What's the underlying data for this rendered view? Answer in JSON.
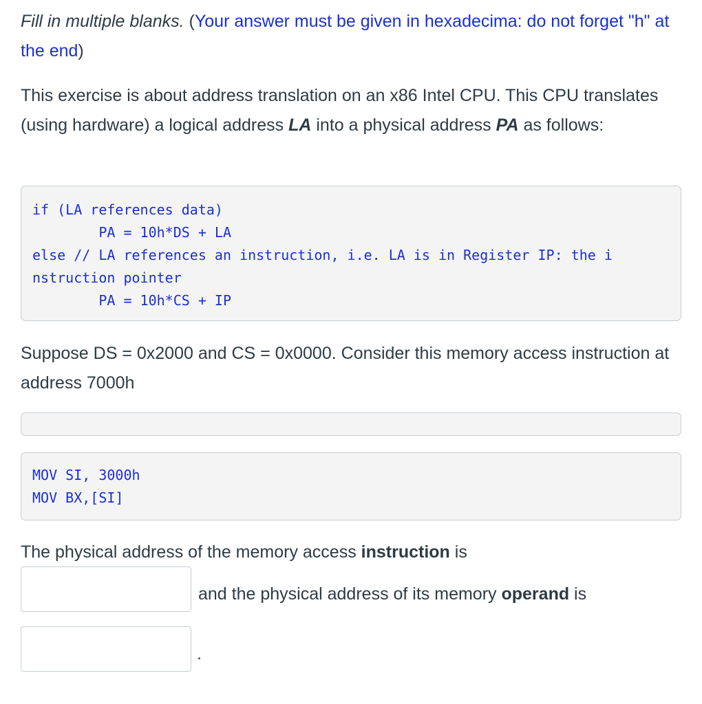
{
  "instructions": {
    "type_label": "Fill in multiple blanks.",
    "note": "(Your answer must be given in hexadecima: do not forget \"h\" at the end)",
    "note_open": "(",
    "note_text": "Your answer must be given in hexadecima: do not forget \"h\" at the end",
    "note_close": ")"
  },
  "description": {
    "part1": "This exercise is about address translation on an x86 Intel CPU. This CPU translates (using hardware) a logical address ",
    "la": "LA",
    "part2": " into a physical address ",
    "pa": "PA",
    "part3": " as follows:"
  },
  "code_block_1": {
    "lines": [
      "if (LA references data)",
      "        PA = 10h*DS + LA",
      "else // LA references an instruction, i.e. LA is in Register IP: the i",
      "nstruction pointer",
      "        PA = 10h*CS + IP"
    ]
  },
  "setup": {
    "text": "Suppose DS = 0x2000 and CS = 0x0000. Consider this memory access instruction at address 7000h"
  },
  "code_block_2": {
    "lines": [
      "MOV SI, 3000h",
      "MOV BX,[SI]"
    ]
  },
  "question": {
    "part1": "The physical address of the memory access ",
    "bold1": "instruction",
    "part2": " is",
    "part3": "and the physical address of its memory ",
    "bold2": "operand",
    "part4": " is",
    "end": "."
  },
  "blanks": [
    {
      "value": "",
      "placeholder": ""
    },
    {
      "value": "",
      "placeholder": ""
    }
  ]
}
